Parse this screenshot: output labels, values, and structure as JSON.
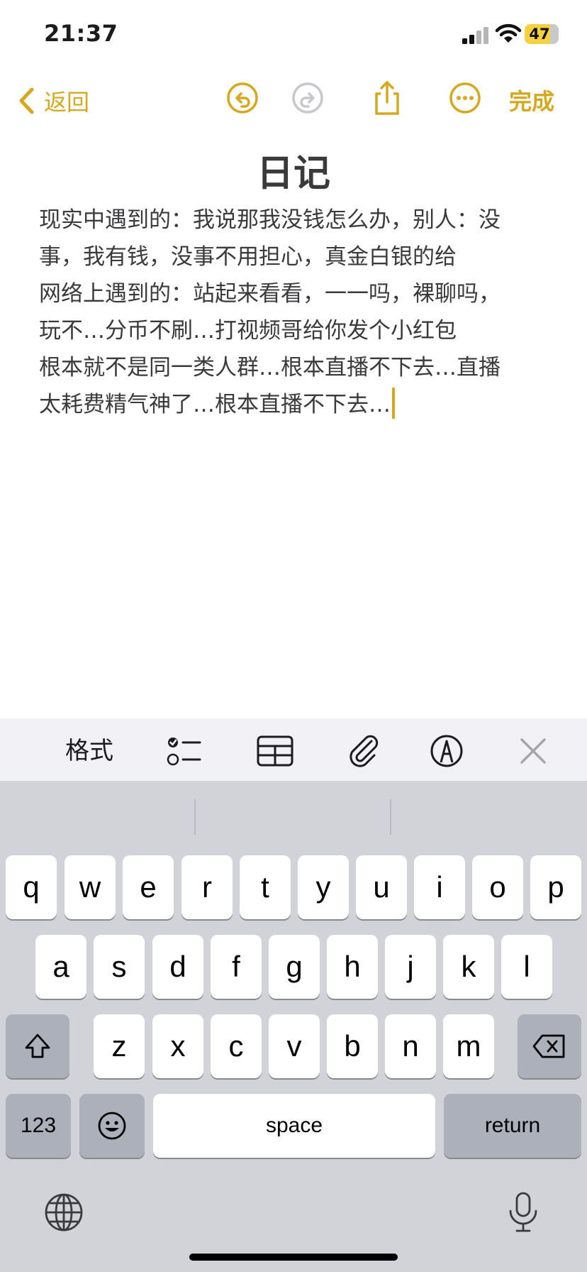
{
  "status_bar": {
    "time": "21:37",
    "battery": "47"
  },
  "nav": {
    "back_label": "返回",
    "done_label": "完成",
    "accent_color": "#d6a81e",
    "icons": [
      "chevron-left-icon",
      "undo-icon",
      "redo-icon",
      "share-icon",
      "more-icon"
    ]
  },
  "note": {
    "title": "日记",
    "lines": [
      "现实中遇到的：我说那我没钱怎么办，别人：没",
      "事，我有钱，没事不用担心，真金白银的给",
      "网络上遇到的：站起来看看，一一吗，裸聊吗，",
      "玩不…分币不刷…打视频哥给你发个小红包",
      "根本就不是同一类人群…根本直播不下去…直播",
      "太耗费精气神了…根本直播不下去…"
    ]
  },
  "toolbar": {
    "format_label": "格式",
    "icons": [
      "checklist-icon",
      "table-icon",
      "attachment-icon",
      "markup-icon",
      "close-icon"
    ]
  },
  "keyboard": {
    "row1": [
      "q",
      "w",
      "e",
      "r",
      "t",
      "y",
      "u",
      "i",
      "o",
      "p"
    ],
    "row2": [
      "a",
      "s",
      "d",
      "f",
      "g",
      "h",
      "j",
      "k",
      "l"
    ],
    "row3": [
      "z",
      "x",
      "c",
      "v",
      "b",
      "n",
      "m"
    ],
    "numbers_label": "123",
    "space_label": "space",
    "return_label": "return"
  }
}
